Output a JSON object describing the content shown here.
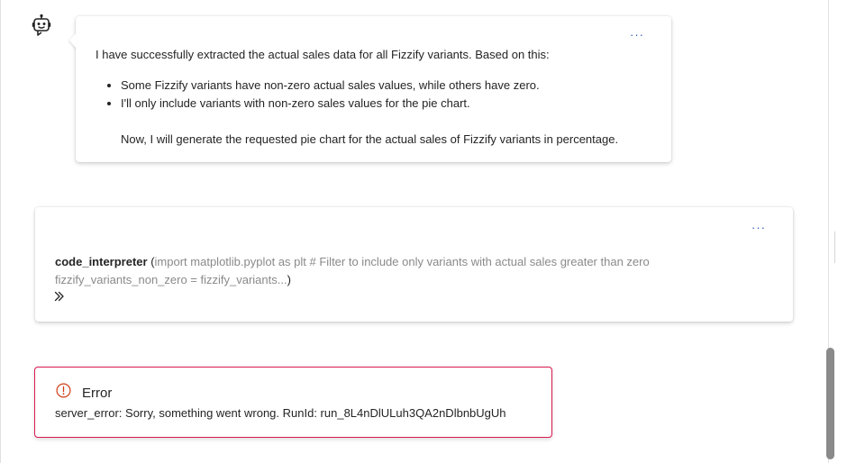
{
  "assistant_message": {
    "intro": "I have successfully extracted the actual sales data for all Fizzify variants. Based on this:",
    "bullets": [
      "Some Fizzify variants have non-zero actual sales values, while others have zero.",
      "I'll only include variants with non-zero sales values for the pie chart."
    ],
    "closing": "Now, I will generate the requested pie chart for the actual sales of Fizzify variants in percentage.",
    "more_label": "···"
  },
  "tool_call": {
    "name": "code_interpreter",
    "open_paren": " (",
    "args": "import matplotlib.pyplot as plt # Filter to include only variants with actual sales greater than zero fizzify_variants_non_zero = fizzify_variants...",
    "close_paren": ")",
    "more_label": "···",
    "expand_icon": "double-chevron-right-icon"
  },
  "error": {
    "title": "Error",
    "message": "server_error: Sorry, something went wrong. RunId: run_8L4nDlULuh3QA2nDlbnbUgUh",
    "icon": "error-circle-icon"
  },
  "colors": {
    "accent": "#2a56b8",
    "error": "#d9184f",
    "muted_text": "#8a8a8a",
    "text": "#242424"
  }
}
